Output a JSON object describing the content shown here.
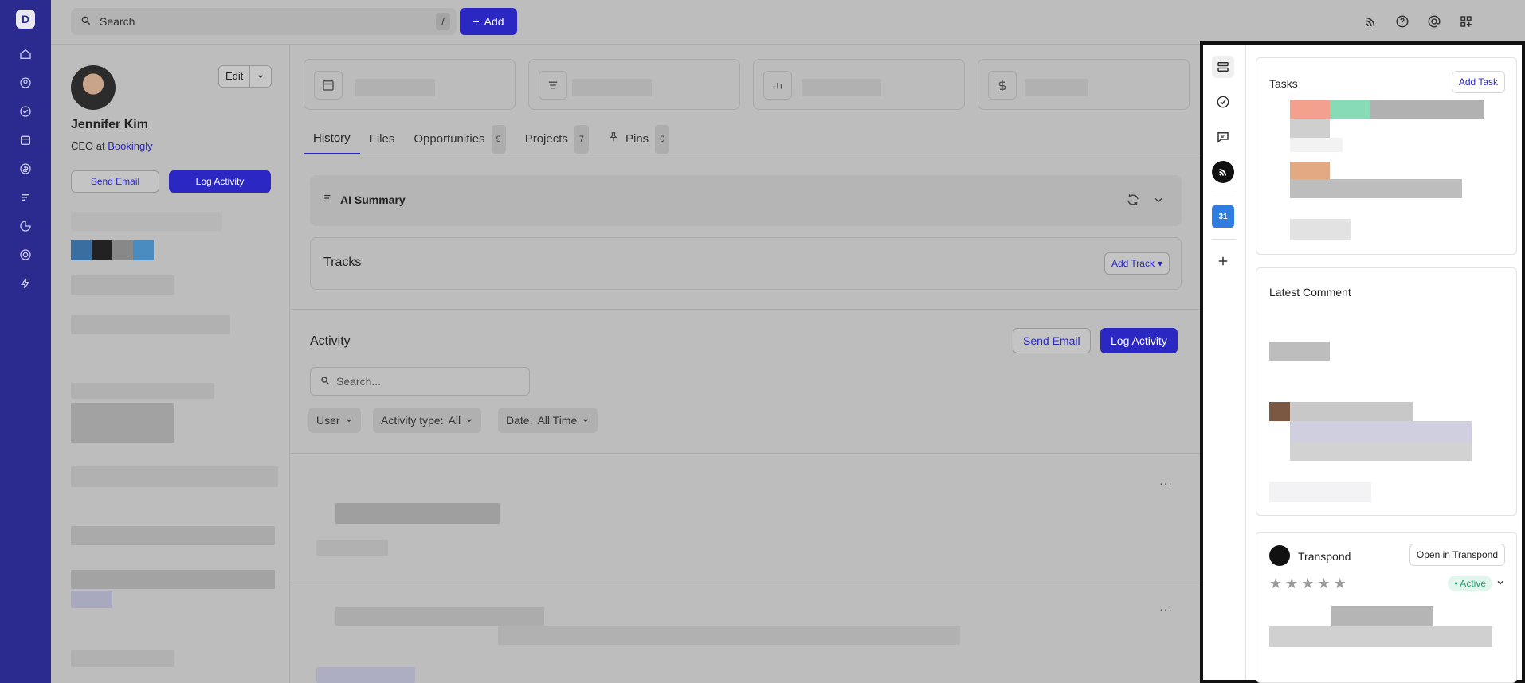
{
  "app": {
    "logo_letter": "D"
  },
  "topbar": {
    "search_placeholder": "Search",
    "search_shortcut": "/",
    "add_label": "Add"
  },
  "profile": {
    "name": "Jennifer Kim",
    "role_prefix": "CEO at",
    "company": "Bookingly",
    "edit_label": "Edit",
    "send_email_label": "Send Email",
    "log_activity_label": "Log Activity"
  },
  "tabs": [
    {
      "label": "History",
      "count": ""
    },
    {
      "label": "Files",
      "count": ""
    },
    {
      "label": "Opportunities",
      "count": "9"
    },
    {
      "label": "Projects",
      "count": "7"
    },
    {
      "label": "Pins",
      "count": "0"
    }
  ],
  "ai_summary": {
    "label": "AI Summary"
  },
  "tracks": {
    "label": "Tracks",
    "add_label": "Add Track"
  },
  "activity": {
    "title": "Activity",
    "send_email_label": "Send Email",
    "log_activity_label": "Log Activity",
    "search_placeholder": "Search...",
    "filters": {
      "user": "User",
      "type_label": "Activity type:",
      "type_value": "All",
      "date_label": "Date:",
      "date_value": "All Time"
    }
  },
  "right_panel": {
    "tasks": {
      "title": "Tasks",
      "add_label": "Add Task"
    },
    "latest_comment": {
      "title": "Latest Comment"
    },
    "transpond": {
      "title": "Transpond",
      "open_label": "Open in Transpond",
      "status": "• Active",
      "rating": 0,
      "rating_max": 5,
      "calendar_badge": "31"
    }
  },
  "colors": {
    "brand": "#2b27c3",
    "rail": "#2b2b8f",
    "active_green": "#1f9d6c"
  }
}
